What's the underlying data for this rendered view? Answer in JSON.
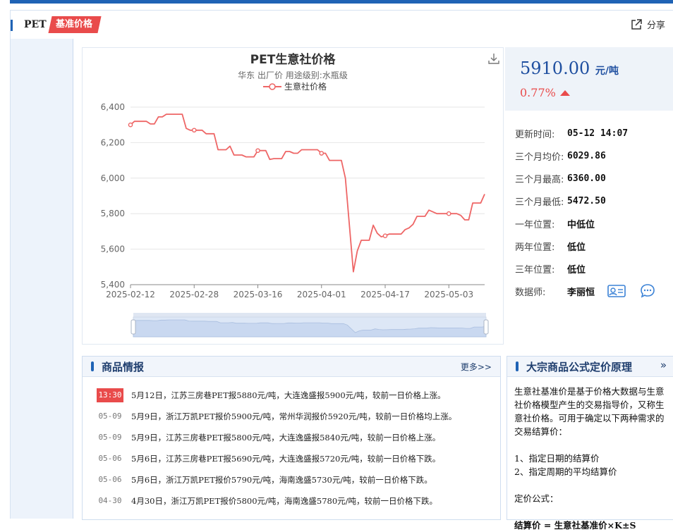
{
  "header": {
    "product": "PET",
    "tag": "基准价格",
    "share_label": "分享"
  },
  "chart_data": {
    "type": "line",
    "title": "PET生意社价格",
    "subtitle": "华东 出厂价 用途级别:水瓶级",
    "legend": "生意社价格",
    "ylim": [
      5400,
      6400
    ],
    "yticks": [
      "6,400",
      "6,200",
      "6,000",
      "5,800",
      "5,600",
      "5,400"
    ],
    "xticks": [
      "2025-02-12",
      "2025-02-28",
      "2025-03-16",
      "2025-04-01",
      "2025-04-17",
      "2025-05-03"
    ],
    "x_range": [
      "2025-02-12",
      "2025-05-12"
    ],
    "series": [
      {
        "name": "生意社价格",
        "color": "#ee6666",
        "points": [
          [
            "2025-02-12",
            6300
          ],
          [
            "2025-02-13",
            6320
          ],
          [
            "2025-02-14",
            6320
          ],
          [
            "2025-02-15",
            6320
          ],
          [
            "2025-02-16",
            6320
          ],
          [
            "2025-02-17",
            6305
          ],
          [
            "2025-02-18",
            6305
          ],
          [
            "2025-02-19",
            6345
          ],
          [
            "2025-02-20",
            6345
          ],
          [
            "2025-02-21",
            6360
          ],
          [
            "2025-02-22",
            6360
          ],
          [
            "2025-02-23",
            6360
          ],
          [
            "2025-02-24",
            6360
          ],
          [
            "2025-02-25",
            6360
          ],
          [
            "2025-02-26",
            6280
          ],
          [
            "2025-02-27",
            6270
          ],
          [
            "2025-02-28",
            6270
          ],
          [
            "2025-03-01",
            6270
          ],
          [
            "2025-03-02",
            6270
          ],
          [
            "2025-03-03",
            6250
          ],
          [
            "2025-03-04",
            6250
          ],
          [
            "2025-03-05",
            6250
          ],
          [
            "2025-03-06",
            6160
          ],
          [
            "2025-03-07",
            6160
          ],
          [
            "2025-03-08",
            6160
          ],
          [
            "2025-03-09",
            6180
          ],
          [
            "2025-03-10",
            6130
          ],
          [
            "2025-03-11",
            6130
          ],
          [
            "2025-03-12",
            6130
          ],
          [
            "2025-03-13",
            6120
          ],
          [
            "2025-03-14",
            6120
          ],
          [
            "2025-03-15",
            6120
          ],
          [
            "2025-03-16",
            6155
          ],
          [
            "2025-03-17",
            6155
          ],
          [
            "2025-03-18",
            6155
          ],
          [
            "2025-03-19",
            6105
          ],
          [
            "2025-03-20",
            6110
          ],
          [
            "2025-03-21",
            6110
          ],
          [
            "2025-03-22",
            6110
          ],
          [
            "2025-03-23",
            6150
          ],
          [
            "2025-03-24",
            6150
          ],
          [
            "2025-03-25",
            6140
          ],
          [
            "2025-03-26",
            6140
          ],
          [
            "2025-03-27",
            6160
          ],
          [
            "2025-03-28",
            6160
          ],
          [
            "2025-03-29",
            6160
          ],
          [
            "2025-03-30",
            6160
          ],
          [
            "2025-03-31",
            6160
          ],
          [
            "2025-04-01",
            6140
          ],
          [
            "2025-04-02",
            6140
          ],
          [
            "2025-04-03",
            6100
          ],
          [
            "2025-04-04",
            6100
          ],
          [
            "2025-04-05",
            6100
          ],
          [
            "2025-04-06",
            6100
          ],
          [
            "2025-04-07",
            6000
          ],
          [
            "2025-04-09",
            5472.5
          ],
          [
            "2025-04-10",
            5590
          ],
          [
            "2025-04-11",
            5650
          ],
          [
            "2025-04-12",
            5650
          ],
          [
            "2025-04-13",
            5650
          ],
          [
            "2025-04-14",
            5735
          ],
          [
            "2025-04-15",
            5690
          ],
          [
            "2025-04-16",
            5670
          ],
          [
            "2025-04-17",
            5675
          ],
          [
            "2025-04-18",
            5685
          ],
          [
            "2025-04-19",
            5685
          ],
          [
            "2025-04-20",
            5685
          ],
          [
            "2025-04-21",
            5685
          ],
          [
            "2025-04-22",
            5710
          ],
          [
            "2025-04-23",
            5720
          ],
          [
            "2025-04-24",
            5740
          ],
          [
            "2025-04-25",
            5785
          ],
          [
            "2025-04-26",
            5785
          ],
          [
            "2025-04-27",
            5785
          ],
          [
            "2025-04-28",
            5820
          ],
          [
            "2025-04-29",
            5810
          ],
          [
            "2025-04-30",
            5800
          ],
          [
            "2025-05-01",
            5800
          ],
          [
            "2025-05-02",
            5800
          ],
          [
            "2025-05-03",
            5800
          ],
          [
            "2025-05-04",
            5800
          ],
          [
            "2025-05-05",
            5800
          ],
          [
            "2025-05-06",
            5790
          ],
          [
            "2025-05-07",
            5765
          ],
          [
            "2025-05-08",
            5765
          ],
          [
            "2025-05-09",
            5860
          ],
          [
            "2025-05-10",
            5860
          ],
          [
            "2025-05-11",
            5860
          ],
          [
            "2025-05-12",
            5910
          ]
        ],
        "markers": [
          "2025-02-12",
          "2025-02-28",
          "2025-03-16",
          "2025-04-01",
          "2025-04-17",
          "2025-05-03"
        ]
      }
    ]
  },
  "price": {
    "value": "5910.00",
    "unit": "元/吨",
    "change": "0.77%",
    "direction": "up",
    "stats": [
      {
        "label": "更新时间:",
        "value": "05-12 14:07"
      },
      {
        "label": "三个月均价:",
        "value": "6029.86"
      },
      {
        "label": "三个月最高:",
        "value": "6360.00"
      },
      {
        "label": "三个月最低:",
        "value": "5472.50"
      },
      {
        "label": "一年位置:",
        "value": "中低位"
      },
      {
        "label": "两年位置:",
        "value": "低位"
      },
      {
        "label": "三年位置:",
        "value": "低位"
      },
      {
        "label": "数据师:",
        "value": "李丽恒"
      }
    ]
  },
  "news": {
    "title": "商品情报",
    "more": "更多>>",
    "items": [
      {
        "date": "13:30",
        "hot": true,
        "text": "5月12日，江苏三房巷PET报5880元/吨，大连逸盛报5900元/吨，较前一日价格上涨。"
      },
      {
        "date": "05-09",
        "hot": false,
        "text": "5月9日，浙江万凯PET报价5900元/吨，常州华润报价5920元/吨，较前一日价格均上涨。"
      },
      {
        "date": "05-09",
        "hot": false,
        "text": "5月9日，江苏三房巷PET报5800元/吨，大连逸盛报5840元/吨，较前一日价格上涨。"
      },
      {
        "date": "05-06",
        "hot": false,
        "text": "5月6日，江苏三房巷PET报5690元/吨，大连逸盛报5720元/吨，较前一日价格下跌。"
      },
      {
        "date": "05-06",
        "hot": false,
        "text": "5月6日，浙江万凯PET报价5790元/吨，海南逸盛5730元/吨，较前一日价格下跌。"
      },
      {
        "date": "04-30",
        "hot": false,
        "text": "4月30日，浙江万凯PET报价5800元/吨，海南逸盛5780元/吨，较前一日价格下跌。"
      }
    ]
  },
  "principle": {
    "title": "大宗商品公式定价原理",
    "more": "»",
    "intro": "生意社基准价是基于价格大数据与生意社价格模型产生的交易指导价，又称生意社价格。可用于确定以下两种需求的交易结算价：",
    "item1": "1、指定日期的结算价",
    "item2": "2、指定周期的平均结算价",
    "formula_label": "定价公式：",
    "formula": "结算价 = 生意社基准价×K±S"
  }
}
